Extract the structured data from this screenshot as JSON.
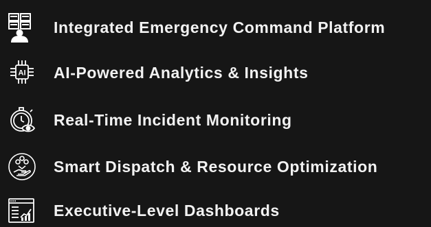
{
  "features": [
    {
      "icon": "command-center-operator-icon",
      "label": "Integrated Emergency Command Platform"
    },
    {
      "icon": "ai-chip-icon",
      "label": "AI-Powered Analytics & Insights"
    },
    {
      "icon": "stopwatch-eye-icon",
      "label": "Real-Time Incident Monitoring"
    },
    {
      "icon": "hand-resources-icon",
      "label": "Smart Dispatch & Resource Optimization"
    },
    {
      "icon": "dashboard-chart-icon",
      "label": "Executive-Level Dashboards"
    }
  ],
  "colors": {
    "background": "#161616",
    "text": "#f2f2f2",
    "icon_stroke": "#ffffff"
  }
}
